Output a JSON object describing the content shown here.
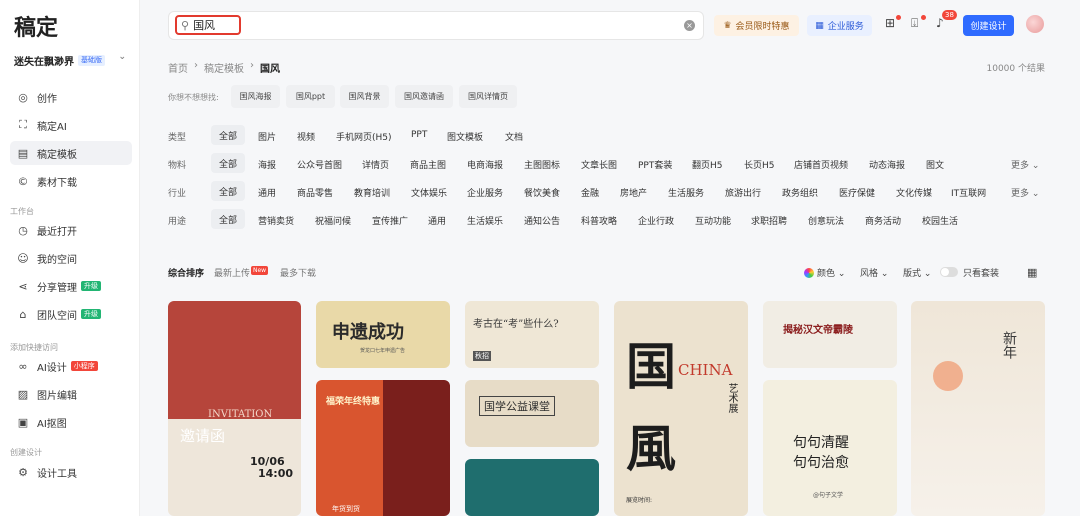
{
  "app": {
    "logo": "稿定"
  },
  "user": {
    "name": "迷失在飘渺界",
    "badge": "基础版"
  },
  "nav": {
    "main": [
      {
        "label": "创作",
        "icon": "compass-icon"
      },
      {
        "label": "稿定AI",
        "icon": "ai-icon"
      },
      {
        "label": "稿定模板",
        "icon": "template-icon"
      },
      {
        "label": "素材下载",
        "icon": "copyright-icon"
      }
    ],
    "workspace_title": "工作台",
    "workspace": [
      {
        "label": "最近打开"
      },
      {
        "label": "我的空间"
      },
      {
        "label": "分享管理",
        "tag": "升级"
      },
      {
        "label": "团队空间",
        "tag": "升级"
      }
    ],
    "quick_title": "添加快捷访问",
    "quick": [
      {
        "label": "AI设计",
        "tag": "小程序"
      },
      {
        "label": "图片编辑"
      },
      {
        "label": "AI抠图"
      }
    ],
    "create_title": "创建设计",
    "create": [
      {
        "label": "设计工具"
      }
    ]
  },
  "search": {
    "value": "国风"
  },
  "topbar": {
    "vip": "会员限时特惠",
    "enterprise": "企业服务",
    "notification_count": "38",
    "create": "创建设计"
  },
  "breadcrumb": {
    "home": "首页",
    "section": "稿定模板",
    "current": "国风"
  },
  "results": "10000 个结果",
  "suggest": {
    "label": "你想不想想找:",
    "chips": [
      "国风海报",
      "国风ppt",
      "国风背景",
      "国风邀请函",
      "国风详情页"
    ]
  },
  "filters": {
    "type": {
      "label": "类型",
      "options": [
        "全部",
        "图片",
        "视频",
        "手机网页(H5)",
        "PPT",
        "图文模板",
        "文档"
      ]
    },
    "material": {
      "label": "物料",
      "options": [
        "全部",
        "海报",
        "公众号首图",
        "详情页",
        "商品主图",
        "电商海报",
        "主图图标",
        "文章长图",
        "PPT套装",
        "翻页H5",
        "长页H5",
        "店铺首页视频",
        "动态海报",
        "图文"
      ],
      "more": "更多"
    },
    "industry": {
      "label": "行业",
      "options": [
        "全部",
        "通用",
        "商品零售",
        "教育培训",
        "文体娱乐",
        "企业服务",
        "餐饮美食",
        "金融",
        "房地产",
        "生活服务",
        "旅游出行",
        "政务组织",
        "医疗保健",
        "文化传媒",
        "IT互联网"
      ],
      "more": "更多"
    },
    "usage": {
      "label": "用途",
      "options": [
        "全部",
        "营销卖货",
        "祝福问候",
        "宣传推广",
        "通用",
        "生活娱乐",
        "通知公告",
        "科普攻略",
        "企业行政",
        "互动功能",
        "求职招聘",
        "创意玩法",
        "商务活动",
        "校园生活"
      ]
    }
  },
  "sort": {
    "items": [
      "综合排序",
      "最新上传",
      "最多下载"
    ],
    "new_badge": "New"
  },
  "view": {
    "color": "颜色",
    "style": "风格",
    "layout": "版式",
    "members_only": "只看套装"
  },
  "cards": {
    "c1": {
      "title": "邀请函",
      "sub": "INVITATION",
      "date": "10/06",
      "time": "14:00"
    },
    "c2": {
      "title": "申遗成功",
      "sub": "贺龙口七年申遗广告"
    },
    "c3": {
      "title": "福荣年终特惠",
      "label": "年货到货"
    },
    "c4": {
      "title": "考古在“考”些什么?",
      "tag": "秋招"
    },
    "c5": {
      "title": "国学公益课堂"
    },
    "c6": {
      "big1": "国",
      "big2": "風",
      "en": "CHINA",
      "side": "艺术展",
      "foot": "展览时间:"
    },
    "c7": {
      "title": "揭秘汉文帝霸陵"
    },
    "c8": {
      "line1": "句句清醒",
      "line2": "句句治愈",
      "sub": "@句子文学"
    },
    "c9": {
      "title": "新年"
    }
  }
}
